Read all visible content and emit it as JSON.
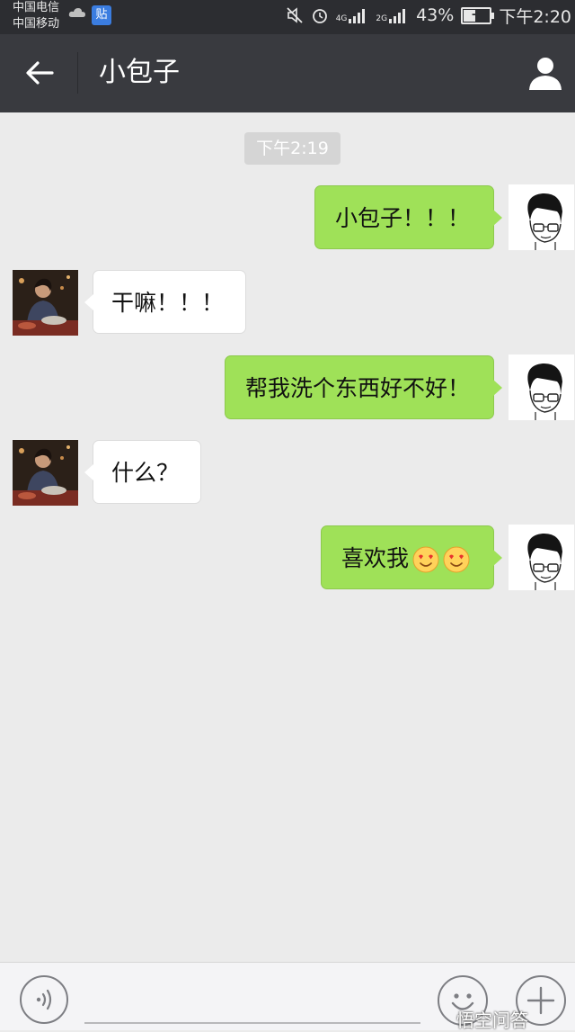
{
  "status_bar": {
    "carrier_1": "中国电信",
    "carrier_2": "中国移动",
    "tieba_badge": "贴",
    "network_1": "4G",
    "network_2": "2G",
    "battery_percent": "43%",
    "battery_level": 0.43,
    "time": "下午2:20"
  },
  "header": {
    "title": "小包子"
  },
  "chat": {
    "timestamp": "下午2:19",
    "messages": [
      {
        "direction": "out",
        "text": "小包子！！！"
      },
      {
        "direction": "in",
        "text": "干嘛！！！"
      },
      {
        "direction": "out",
        "text": "帮我洗个东西好不好！"
      },
      {
        "direction": "in",
        "text": "什么？"
      },
      {
        "direction": "out",
        "text": "喜欢我",
        "emojis": [
          "heart-eyes-emoji",
          "heart-eyes-emoji"
        ]
      }
    ]
  },
  "input_bar": {
    "watermark": "悟空问答"
  },
  "colors": {
    "header_bg": "#393a3f",
    "status_bg": "#2c2d31",
    "chat_bg": "#ebebeb",
    "outgoing_bubble": "#9fe158",
    "incoming_bubble": "#ffffff"
  }
}
